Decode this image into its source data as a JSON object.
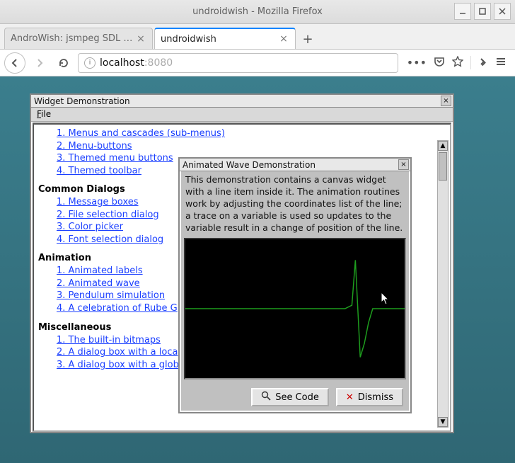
{
  "firefox": {
    "title": "undroidwish - Mozilla Firefox",
    "tabs": [
      {
        "label": "AndroWish: jsmpeg SDL Vide",
        "active": false
      },
      {
        "label": "undroidwish",
        "active": true
      }
    ],
    "url_host": "localhost",
    "url_port": ":8080"
  },
  "widget_window": {
    "title": "Widget Demonstration",
    "menu_file": "File",
    "links_top": [
      "1. Menus and cascades (sub-menus)",
      "2. Menu-buttons",
      "3. Themed menu buttons",
      "4. Themed toolbar"
    ],
    "heading_dialogs": "Common Dialogs",
    "links_dialogs": [
      "1. Message boxes",
      "2. File selection dialog",
      "3. Color picker",
      "4. Font selection dialog"
    ],
    "heading_anim": "Animation",
    "links_anim": [
      "1. Animated labels",
      "2. Animated wave",
      "3. Pendulum simulation",
      "4. A celebration of Rube G"
    ],
    "heading_misc": "Miscellaneous",
    "links_misc": [
      "1. The built-in bitmaps",
      "2. A dialog box with a loca",
      "3. A dialog box with a glob"
    ]
  },
  "wave_window": {
    "title": "Animated Wave Demonstration",
    "description": "This demonstration contains a canvas widget with a line item inside it. The animation routines work by adjusting the coordinates list of the line; a trace on a variable is used so updates to the variable result in a change of position of the line.",
    "see_code": "See Code",
    "dismiss": "Dismiss"
  }
}
